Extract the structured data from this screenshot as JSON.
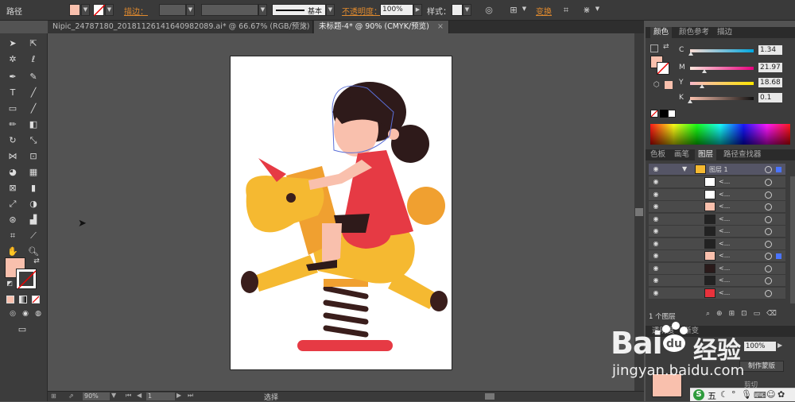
{
  "control_bar": {
    "selection_type": "路径",
    "stroke_label": "描边：",
    "stroke_style": "基本",
    "opacity_label": "不透明度：",
    "opacity_value": "100%",
    "style_label": "样式：",
    "transform_label": "变换",
    "fill_color": "#f9c0ad"
  },
  "tabs": [
    {
      "label": "Nipic_24787180_20181126141640982089.ai* @ 66.67% (RGB/预览)",
      "active": false
    },
    {
      "label": "未标题-4* @ 90% (CMYK/预览)",
      "active": true
    }
  ],
  "color_panel": {
    "tabs": [
      "颜色",
      "颜色参考",
      "描边"
    ],
    "active_tab": 0,
    "channels": [
      {
        "letter": "C",
        "value": "1.34",
        "fraction": 0.0134,
        "gradient": "linear-gradient(90deg,#fbdcd3,#00a7e0)"
      },
      {
        "letter": "M",
        "value": "21.97",
        "fraction": 0.2197,
        "gradient": "linear-gradient(90deg,#ffe7dd,#e6007e)"
      },
      {
        "letter": "Y",
        "value": "18.68",
        "fraction": 0.1868,
        "gradient": "linear-gradient(90deg,#f8b8c8,#ffe500)"
      },
      {
        "letter": "K",
        "value": "0.1",
        "fraction": 0.001,
        "gradient": "linear-gradient(90deg,#f9c0ad,#111)"
      }
    ]
  },
  "layers_panel": {
    "tabs": [
      "色板",
      "画笔",
      "图层",
      "路径查找器"
    ],
    "active_tab": 2,
    "top_layer_name": "图层 1",
    "sublayer_placeholder": "<...",
    "footer_text": "1 个图层",
    "sublayer_thumb_colors": [
      "#ffffff",
      "#ffffff",
      "#f9c0ad",
      "#222222",
      "#222222",
      "#222222",
      "#f9c0ad",
      "#2a1a1a",
      "#222222",
      "#e8323c"
    ]
  },
  "bottom_panel": {
    "tabs": [
      "透明度",
      "渐变"
    ],
    "opacity_value": "100%",
    "mask_button": "制作蒙版",
    "clip_label": "剪切"
  },
  "status_bar": {
    "zoom": "90%",
    "page": "1",
    "mode": "选择"
  },
  "watermark": {
    "brand": "Bai",
    "brand_cn": "经验",
    "url": "jingyan.baidu.com"
  },
  "taskbar": {
    "ime_label": "五"
  }
}
